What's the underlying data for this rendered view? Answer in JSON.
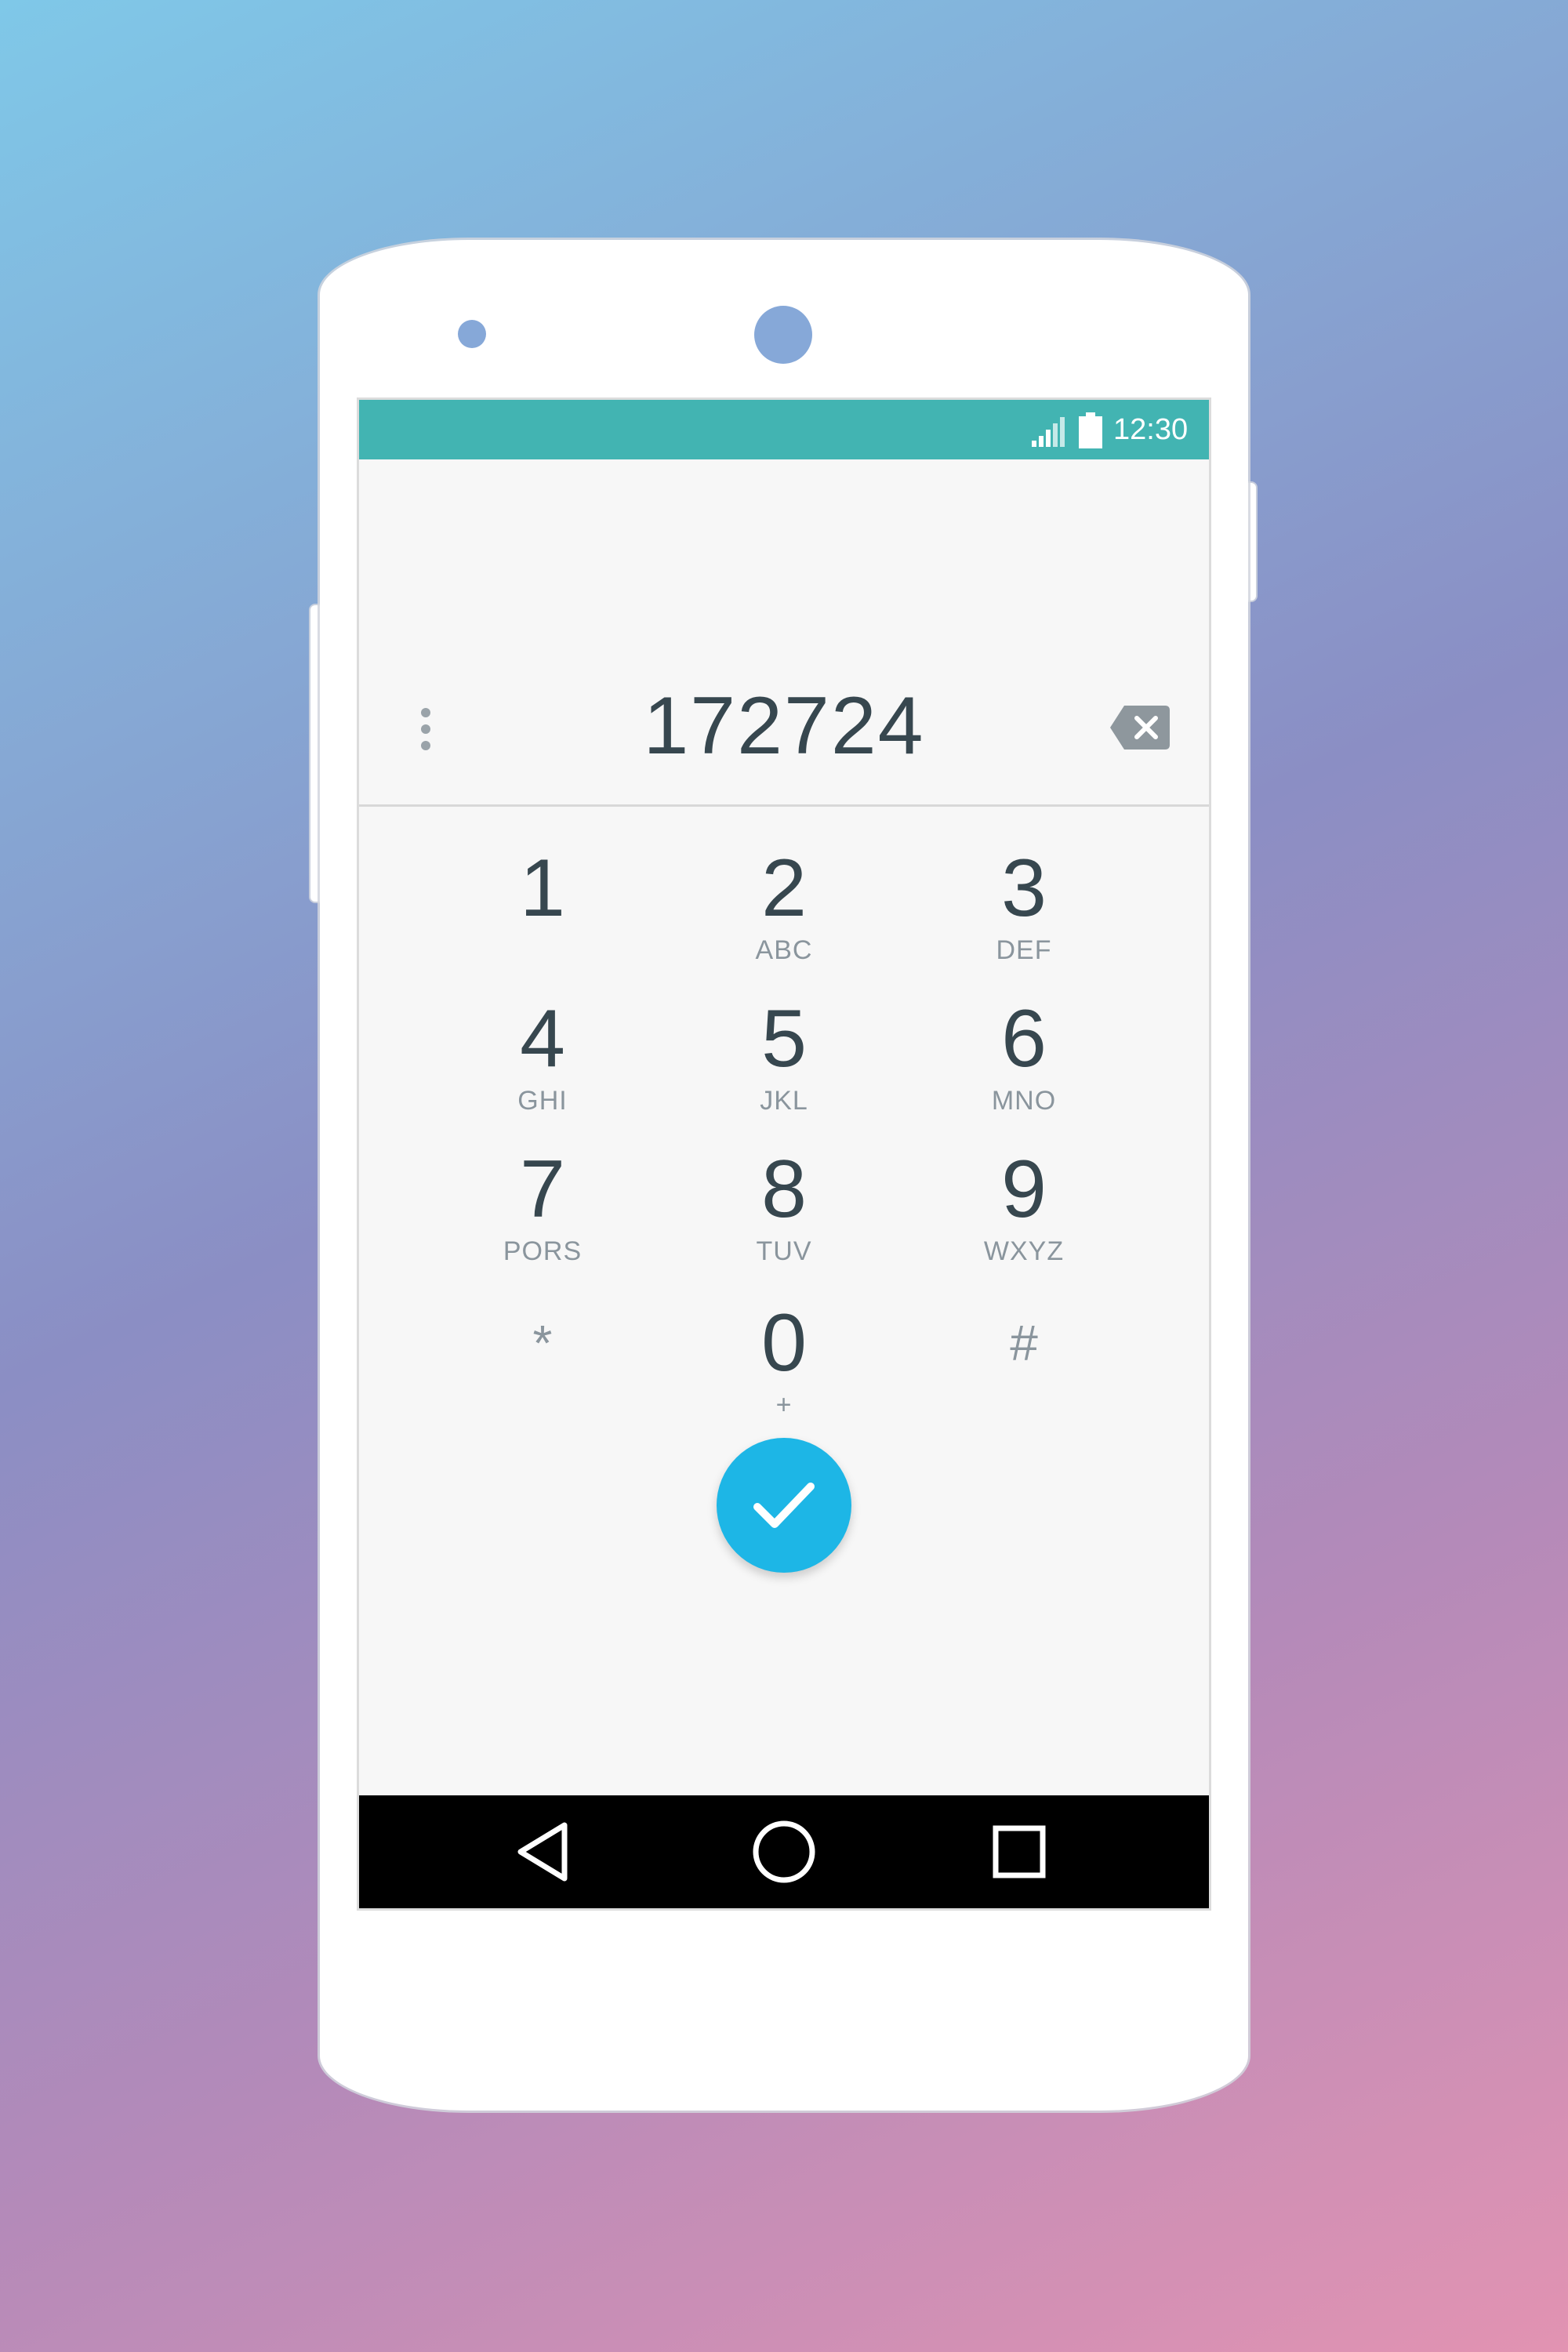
{
  "status_bar": {
    "time": "12:30",
    "signal_icon": "signal-icon",
    "battery_icon": "battery-icon"
  },
  "dialer": {
    "number": "172724",
    "overflow_icon": "more-vert-icon",
    "backspace_icon": "backspace-icon",
    "keys": [
      {
        "digit": "1",
        "letters": ""
      },
      {
        "digit": "2",
        "letters": "ABC"
      },
      {
        "digit": "3",
        "letters": "DEF"
      },
      {
        "digit": "4",
        "letters": "GHI"
      },
      {
        "digit": "5",
        "letters": "JKL"
      },
      {
        "digit": "6",
        "letters": "MNO"
      },
      {
        "digit": "7",
        "letters": "PORS"
      },
      {
        "digit": "8",
        "letters": "TUV"
      },
      {
        "digit": "9",
        "letters": "WXYZ"
      },
      {
        "digit": "*",
        "letters": ""
      },
      {
        "digit": "0",
        "letters": "+"
      },
      {
        "digit": "#",
        "letters": ""
      }
    ],
    "call_button_icon": "check-icon"
  },
  "nav_bar": {
    "back_icon": "back-triangle-icon",
    "home_icon": "home-circle-icon",
    "recents_icon": "recents-square-icon"
  },
  "colors": {
    "status_bar": "#42b4b2",
    "accent": "#1db6e6",
    "text_primary": "#37474f",
    "text_secondary": "#8a959d"
  }
}
